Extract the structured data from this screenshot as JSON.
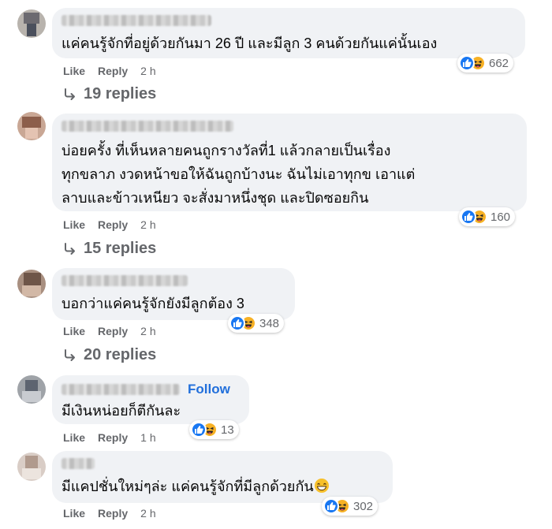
{
  "labels": {
    "like": "Like",
    "reply": "Reply",
    "follow": "Follow"
  },
  "comments": [
    {
      "text": "แค่คนรู้จักที่อยู่ด้วยกันมา 26 ปี และมีลูก 3 คนด้วยกันแค่นั้นเอง",
      "time": "2 h",
      "reactions": "662",
      "replies": "19 replies"
    },
    {
      "text": "บ่อยครั้ง ที่เห็นหลายคนถูกรางวัลที่1 แล้วกลายเป็นเรื่อง\nทุกขลาภ งวดหน้าขอให้ฉันถูกบ้างนะ ฉันไม่เอาทุกข เอาแต่\nลาบและข้าวเหนียว จะสั่งมาหนึ่งชุด และปิดซอยกิน",
      "time": "2 h",
      "reactions": "160",
      "replies": "15 replies"
    },
    {
      "text": "บอกว่าแค่คนรู้จักยังมีลูกต้อง 3",
      "time": "2 h",
      "reactions": "348",
      "replies": "20 replies"
    },
    {
      "text": "มีเงินหน่อยก็ตีกันละ",
      "time": "1 h",
      "reactions": "13"
    },
    {
      "text": "มีแคปชั่นใหม่ๆล่ะ แค่คนรู้จักที่มีลูกด้วยกัน",
      "time": "2 h",
      "reactions": "302",
      "inline_emoji": "grinning-face-emoji"
    }
  ],
  "colors": {
    "bubble": "#f0f2f5",
    "meta": "#65676b",
    "follow": "#216fdb",
    "like": "#1877f2",
    "haha": "#f7b125"
  }
}
